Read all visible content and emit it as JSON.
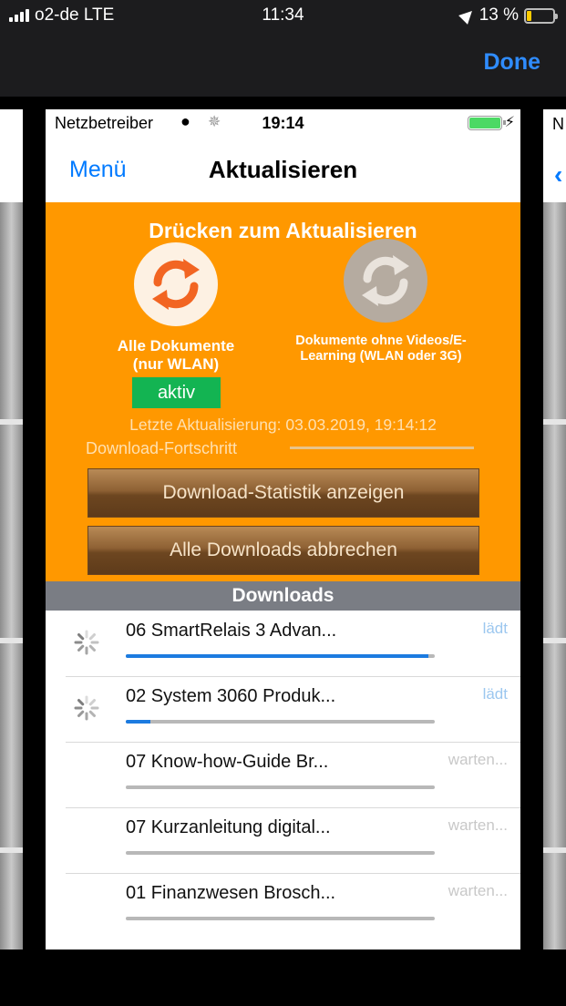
{
  "outer_status": {
    "carrier": "o2-de LTE",
    "time": "11:34",
    "battery": "13 %"
  },
  "header": {
    "done_label": "Done"
  },
  "side_cards": {
    "left_text": "",
    "right_text": "N"
  },
  "inner_status": {
    "carrier": "Netzbetreiber",
    "time": "19:14"
  },
  "nav": {
    "menu_label": "Menü",
    "title": "Aktualisieren"
  },
  "update_panel": {
    "title": "Drücken zum Aktualisieren",
    "option_all": {
      "label": "Alle Dokumente (nur WLAN)",
      "badge": "aktiv"
    },
    "option_no_video": {
      "label": "Dokumente ohne Videos/E-Learning (WLAN oder 3G)"
    },
    "last_update": "Letzte Aktualisierung: 03.03.2019, 19:14:12",
    "progress_label": "Download-Fortschritt",
    "progress": 0.0,
    "stats_button": "Download-Statistik anzeigen",
    "cancel_button": "Alle Downloads abbrechen"
  },
  "downloads": {
    "header": "Downloads",
    "items": [
      {
        "title": "06 SmartRelais 3 Advan...",
        "status": "lädt",
        "progress": 0.98,
        "loading": true
      },
      {
        "title": "02 System 3060 Produk...",
        "status": "lädt",
        "progress": 0.08,
        "loading": true
      },
      {
        "title": "07 Know-how-Guide Br...",
        "status": "warten...",
        "progress": 0,
        "loading": false
      },
      {
        "title": "07 Kurzanleitung digital...",
        "status": "warten...",
        "progress": 0,
        "loading": false
      },
      {
        "title": "01 Finanzwesen Brosch...",
        "status": "warten...",
        "progress": 0,
        "loading": false
      }
    ]
  },
  "colors": {
    "accent": "#007aff",
    "panel": "#ff9800",
    "active_badge": "#13b452",
    "progress": "#1c7be0"
  }
}
